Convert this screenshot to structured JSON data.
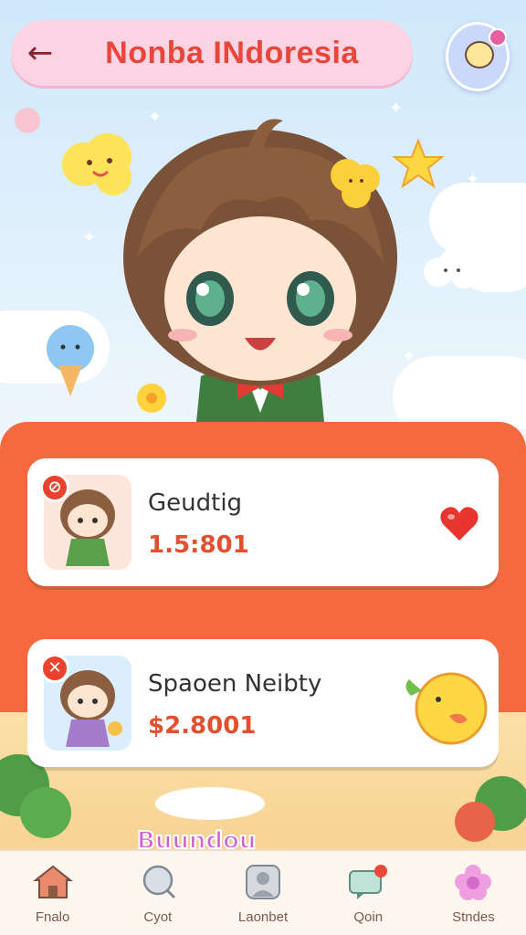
{
  "header": {
    "title": "Nonba INdoresia",
    "back_icon": "arrow-left-icon",
    "mascot_icon": "ufo-mascot-icon"
  },
  "items": [
    {
      "name": "Geudtig",
      "price": "1.5:801",
      "thumb_icon": "chibi-girl-green-dress",
      "badge_icon": "slash-icon",
      "badge_glyph": "⊘",
      "action_icon": "heart-icon"
    },
    {
      "name": "Spaoen Neibty",
      "price": "$2.8001",
      "thumb_icon": "chibi-girl-purple-dress",
      "badge_icon": "close-icon",
      "badge_glyph": "✕",
      "action_icon": "chick-icon"
    }
  ],
  "banner": {
    "text": "Buundou"
  },
  "tabs": [
    {
      "label": "Fnalo",
      "icon": "home-icon"
    },
    {
      "label": "Cyot",
      "icon": "chat-bubble-icon"
    },
    {
      "label": "Laonbet",
      "icon": "profile-icon"
    },
    {
      "label": "Qoin",
      "icon": "message-icon"
    },
    {
      "label": "Stndes",
      "icon": "flower-icon"
    }
  ],
  "colors": {
    "accent": "#f5693f",
    "title": "#e8463b",
    "price": "#e2502f",
    "header_bg": "#fbd3e2"
  }
}
